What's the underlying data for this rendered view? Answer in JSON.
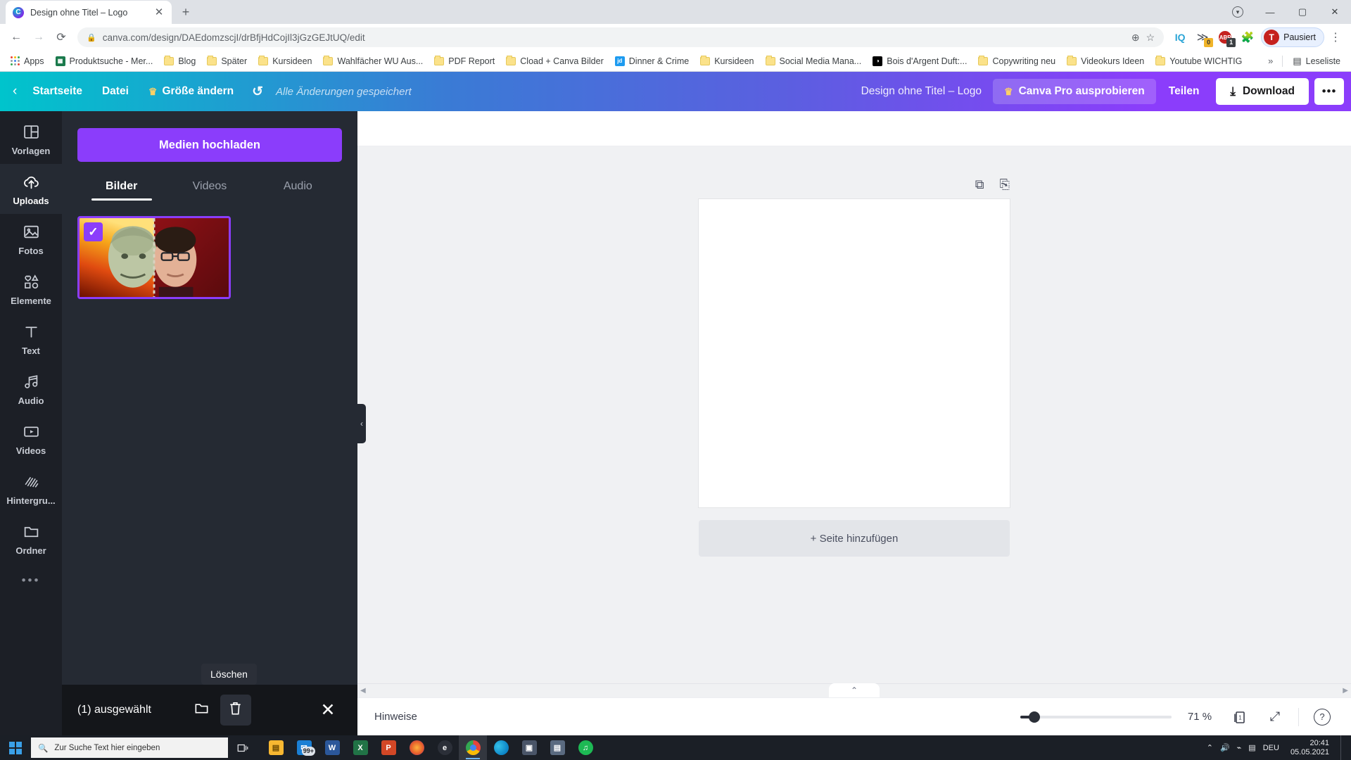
{
  "browser": {
    "tab": {
      "title": "Design ohne Titel – Logo",
      "favicon_name": "canva-favicon",
      "close_label": "✕"
    },
    "newtab_label": "+",
    "window_controls": {
      "extensions": "⊙",
      "minimize": "—",
      "maximize": "▢",
      "close": "✕"
    },
    "nav": {
      "back": "←",
      "forward": "→",
      "reload": "⟳"
    },
    "omnibox": {
      "lock_icon": "🔒",
      "url": "canva.com/design/DAEdomzscjI/drBfjHdCojIl3jGzGEJtUQ/edit",
      "zoom_icon": "⊕",
      "star_icon": "☆"
    },
    "toolbar_extensions": [
      {
        "name": "iq-extension",
        "label": "IQ",
        "color": "#29a4d6",
        "badge": "",
        "badge_color": ""
      },
      {
        "name": "bird-extension",
        "label": "≫",
        "color": "#4a4f58",
        "badge": "0",
        "badge_color": "#f0b429"
      },
      {
        "name": "abp-extension",
        "label": "ABP",
        "color": "#c5221f",
        "badge": "1",
        "badge_color": "#3c4043"
      },
      {
        "name": "puzzle-extension",
        "label": "🧩",
        "color": "#5f6368",
        "badge": "",
        "badge_color": ""
      }
    ],
    "profile": {
      "initial": "T",
      "label": "Pausiert"
    },
    "menu_label": "⋮",
    "bookmarks": [
      {
        "label": "Apps",
        "icon": "apps-grid-icon"
      },
      {
        "label": "Produktsuche - Mer...",
        "icon": "site-favicon",
        "color": "#1a7a4c"
      },
      {
        "label": "Blog",
        "icon": "folder-icon"
      },
      {
        "label": "Später",
        "icon": "folder-icon"
      },
      {
        "label": "Kursideen",
        "icon": "folder-icon"
      },
      {
        "label": "Wahlfächer WU Aus...",
        "icon": "folder-icon"
      },
      {
        "label": "PDF Report",
        "icon": "folder-icon"
      },
      {
        "label": "Cload + Canva Bilder",
        "icon": "folder-icon"
      },
      {
        "label": "Dinner & Crime",
        "icon": "site-favicon",
        "color": "#1d9bf0",
        "text": "jd"
      },
      {
        "label": "Kursideen",
        "icon": "folder-icon"
      },
      {
        "label": "Social Media Mana...",
        "icon": "folder-icon"
      },
      {
        "label": "Bois d'Argent Duft:...",
        "icon": "site-favicon",
        "color": "#000000",
        "text": "◑"
      },
      {
        "label": "Copywriting neu",
        "icon": "folder-icon"
      },
      {
        "label": "Videokurs Ideen",
        "icon": "folder-icon"
      },
      {
        "label": "Youtube WICHTIG",
        "icon": "folder-icon"
      }
    ],
    "bookmarks_overflow": "»",
    "reading_list": {
      "label": "Leseliste",
      "icon": "reading-list-icon"
    }
  },
  "canva": {
    "topbar": {
      "back_icon": "‹",
      "home": "Startseite",
      "file": "Datei",
      "resize": "Größe ändern",
      "resize_crown": "♛",
      "undo_icon": "↺",
      "saved_status": "Alle Änderungen gespeichert",
      "design_title": "Design ohne Titel – Logo",
      "pro_crown": "♛",
      "pro_label": "Canva Pro ausprobieren",
      "share": "Teilen",
      "download": "Download",
      "download_icon": "⤓",
      "more": "•••"
    },
    "rail": [
      {
        "label": "Vorlagen",
        "icon": "templates-icon",
        "active": false
      },
      {
        "label": "Uploads",
        "icon": "upload-cloud-icon",
        "active": true
      },
      {
        "label": "Fotos",
        "icon": "photos-icon",
        "active": false
      },
      {
        "label": "Elemente",
        "icon": "elements-icon",
        "active": false
      },
      {
        "label": "Text",
        "icon": "text-icon",
        "active": false
      },
      {
        "label": "Audio",
        "icon": "audio-icon",
        "active": false
      },
      {
        "label": "Videos",
        "icon": "videos-icon",
        "active": false
      },
      {
        "label": "Hintergru...",
        "icon": "background-icon",
        "active": false
      },
      {
        "label": "Ordner",
        "icon": "folder-icon",
        "active": false
      }
    ],
    "rail_more": "•••",
    "panel": {
      "upload_button": "Medien hochladen",
      "tabs": [
        {
          "label": "Bilder",
          "active": true
        },
        {
          "label": "Videos",
          "active": false
        },
        {
          "label": "Audio",
          "active": false
        }
      ],
      "thumbnail": {
        "name": "uploaded-image-thumbnail",
        "checked": true,
        "check_glyph": "✓"
      },
      "selection": {
        "count_label": "(1) ausgewählt",
        "folder_icon": "folder-icon",
        "delete_icon": "trash-icon",
        "close_icon": "✕",
        "tooltip": "Löschen"
      },
      "collapse_icon": "‹"
    },
    "canvas": {
      "duplicate_icon": "⧉",
      "addpage_icon": "⎘",
      "add_page_label": "+ Seite hinzufügen",
      "scroll_left": "◀",
      "scroll_right": "▶",
      "expand_tab_icon": "⌃"
    },
    "bottombar": {
      "notes": "Hinweise",
      "zoom_value": "71 %",
      "pages_icon": "pages-icon",
      "page_number": "1",
      "fullscreen_icon": "⤢",
      "help_icon": "?"
    }
  },
  "taskbar": {
    "start_icon": "windows-logo",
    "search_placeholder": "Zur Suche Text hier eingeben",
    "search_icon": "search-icon",
    "taskview_icon": "task-view-icon",
    "apps": [
      {
        "name": "file-explorer",
        "label": "📁",
        "color": "#f7b731",
        "badge": "",
        "active": false
      },
      {
        "name": "mail-app",
        "label": "✉",
        "color": "#1a7fd4",
        "badge": "99+",
        "active": false
      },
      {
        "name": "word-app",
        "label": "W",
        "color": "#2b579a",
        "badge": "",
        "active": false
      },
      {
        "name": "excel-app",
        "label": "X",
        "color": "#217346",
        "badge": "",
        "active": false
      },
      {
        "name": "powerpoint-app",
        "label": "P",
        "color": "#d24726",
        "badge": "",
        "active": false
      },
      {
        "name": "firefox-app",
        "label": "◉",
        "color": "#e55b2b",
        "badge": "",
        "active": false
      },
      {
        "name": "edge-legacy-app",
        "label": "e",
        "color": "#1b1f26",
        "badge": "",
        "active": false
      },
      {
        "name": "chrome-app",
        "label": "◎",
        "color": "#e8453c",
        "badge": "",
        "active": true
      },
      {
        "name": "edge-app",
        "label": "e",
        "color": "#0c84c6",
        "badge": "",
        "active": false
      },
      {
        "name": "photos-app",
        "label": "▣",
        "color": "#4a5568",
        "badge": "",
        "active": false
      },
      {
        "name": "store-app",
        "label": "▤",
        "color": "#5a6a80",
        "badge": "",
        "active": false
      },
      {
        "name": "spotify-app",
        "label": "♫",
        "color": "#1db954",
        "badge": "",
        "active": false
      }
    ],
    "tray": {
      "chevron": "⌃",
      "volume_icon": "🔊",
      "network_icon": "⌁",
      "keyboard_icon": "⌨",
      "language": "DEU",
      "time": "20:41",
      "date": "05.05.2021"
    }
  }
}
